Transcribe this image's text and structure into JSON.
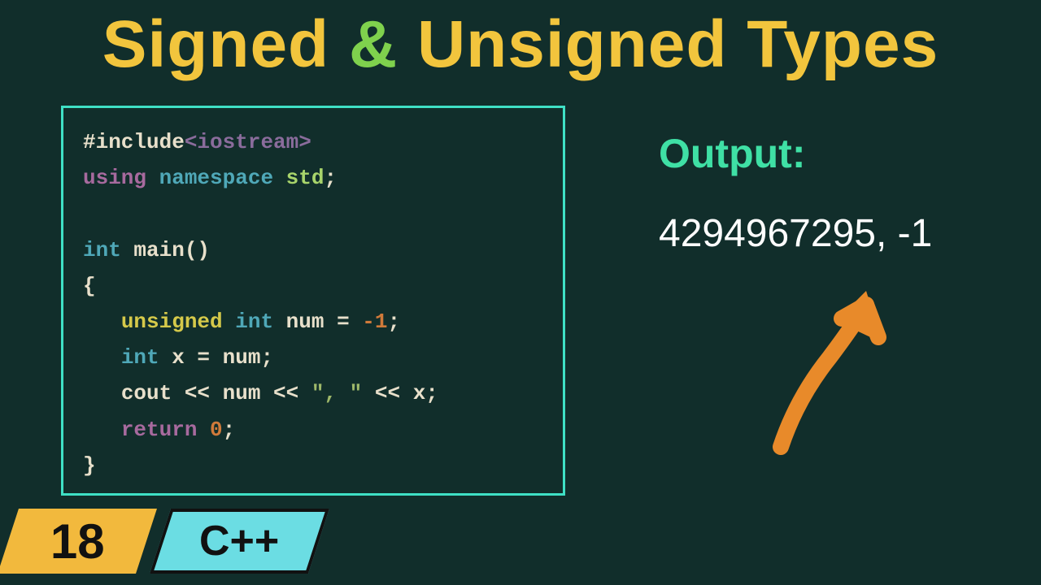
{
  "title": {
    "left": "Signed ",
    "amp": "&",
    "right": " Unsigned Types"
  },
  "code": {
    "line1_include": "#include",
    "line1_header": "<iostream>",
    "line2_using": "using",
    "line2_namespace": " namespace",
    "line2_std": " std",
    "line2_semi": ";",
    "line4_int": "int",
    "line4_main": " main()",
    "line5_brace": "{",
    "line6_indent": "   ",
    "line6_unsigned": "unsigned",
    "line6_int": " int",
    "line6_var": " num = ",
    "line6_val": "-1",
    "line6_semi": ";",
    "line7_indent": "   ",
    "line7_int": "int",
    "line7_rest": " x = num;",
    "line8_indent": "   ",
    "line8_cout": "cout << num << ",
    "line8_str": "\", \"",
    "line8_rest": " << x;",
    "line9_indent": "   ",
    "line9_return": "return",
    "line9_val": " 0",
    "line9_semi": ";",
    "line10_brace": "}"
  },
  "output": {
    "label": "Output:",
    "value": "4294967295, -1"
  },
  "badges": {
    "number": "18",
    "lang": "C++"
  }
}
